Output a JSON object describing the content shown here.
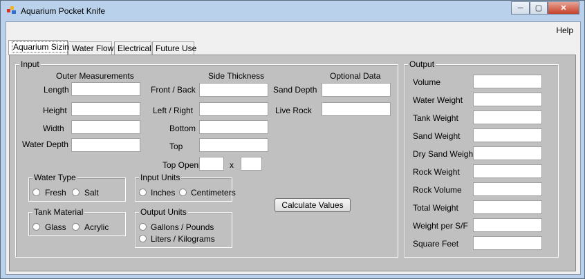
{
  "window": {
    "title": "Aquarium Pocket Knife"
  },
  "menu": {
    "help": "Help"
  },
  "tabs": [
    {
      "label": "Aquarium Sizing"
    },
    {
      "label": "Water Flow"
    },
    {
      "label": "Electrical"
    },
    {
      "label": "Future Use"
    }
  ],
  "input": {
    "group_title": "Input",
    "outer": {
      "heading": "Outer Measurements",
      "length": "Length",
      "height": "Height",
      "width": "Width",
      "water_depth": "Water Depth"
    },
    "side": {
      "heading": "Side Thickness",
      "front_back": "Front / Back",
      "left_right": "Left / Right",
      "bottom": "Bottom",
      "top": "Top"
    },
    "optional": {
      "heading": "Optional Data",
      "sand_depth": "Sand Depth",
      "live_rock": "Live Rock"
    },
    "top_opening": {
      "label": "Top Opening",
      "x": "x"
    },
    "water_type": {
      "title": "Water Type",
      "fresh": "Fresh",
      "salt": "Salt"
    },
    "tank_material": {
      "title": "Tank Material",
      "glass": "Glass",
      "acrylic": "Acrylic"
    },
    "input_units": {
      "title": "Input Units",
      "inches": "Inches",
      "centimeters": "Centimeters"
    },
    "output_units": {
      "title": "Output Units",
      "gallons": "Gallons / Pounds",
      "liters": "Liters / Kilograms"
    },
    "calculate": "Calculate Values"
  },
  "output": {
    "group_title": "Output",
    "fields": [
      {
        "label": "Volume"
      },
      {
        "label": "Water Weight"
      },
      {
        "label": "Tank Weight"
      },
      {
        "label": "Sand Weight"
      },
      {
        "label": "Dry Sand Weight"
      },
      {
        "label": "Rock Weight"
      },
      {
        "label": "Rock Volume"
      },
      {
        "label": "Total Weight"
      },
      {
        "label": "Weight per S/F"
      },
      {
        "label": "Square Feet"
      }
    ]
  }
}
